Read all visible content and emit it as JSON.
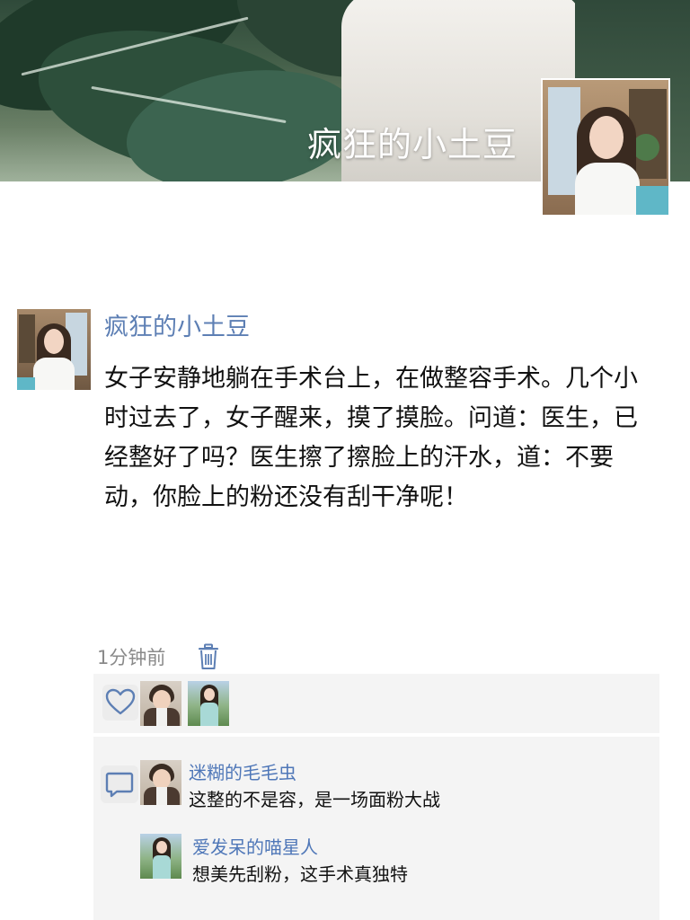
{
  "profile": {
    "cover_title": "疯狂的小土豆"
  },
  "post": {
    "author": "疯狂的小土豆",
    "content": "女子安静地躺在手术台上，在做整容手术。几个小时过去了，女子醒来，摸了摸脸。问道：医生，已经整好了吗？医生擦了擦脸上的汗水，道：不要动，你脸上的粉还没有刮干净呢！",
    "time": "1分钟前",
    "delete_icon": "trash-icon"
  },
  "likes": {
    "icon": "heart-icon",
    "users": [
      "liker-avatar-boy",
      "liker-avatar-girl"
    ]
  },
  "comments": {
    "icon": "comment-bubble-icon",
    "items": [
      {
        "author": "迷糊的毛毛虫",
        "text": "这整的不是容，是一场面粉大战"
      },
      {
        "author": "爱发呆的喵星人",
        "text": "想美先刮粉，这手术真独特"
      }
    ]
  },
  "colors": {
    "link_blue": "#5d7fb4",
    "comment_name_blue": "#4f77b8",
    "timestamp_gray": "#8a8a8a",
    "panel_gray": "#f4f4f4",
    "text_black": "#111111"
  }
}
